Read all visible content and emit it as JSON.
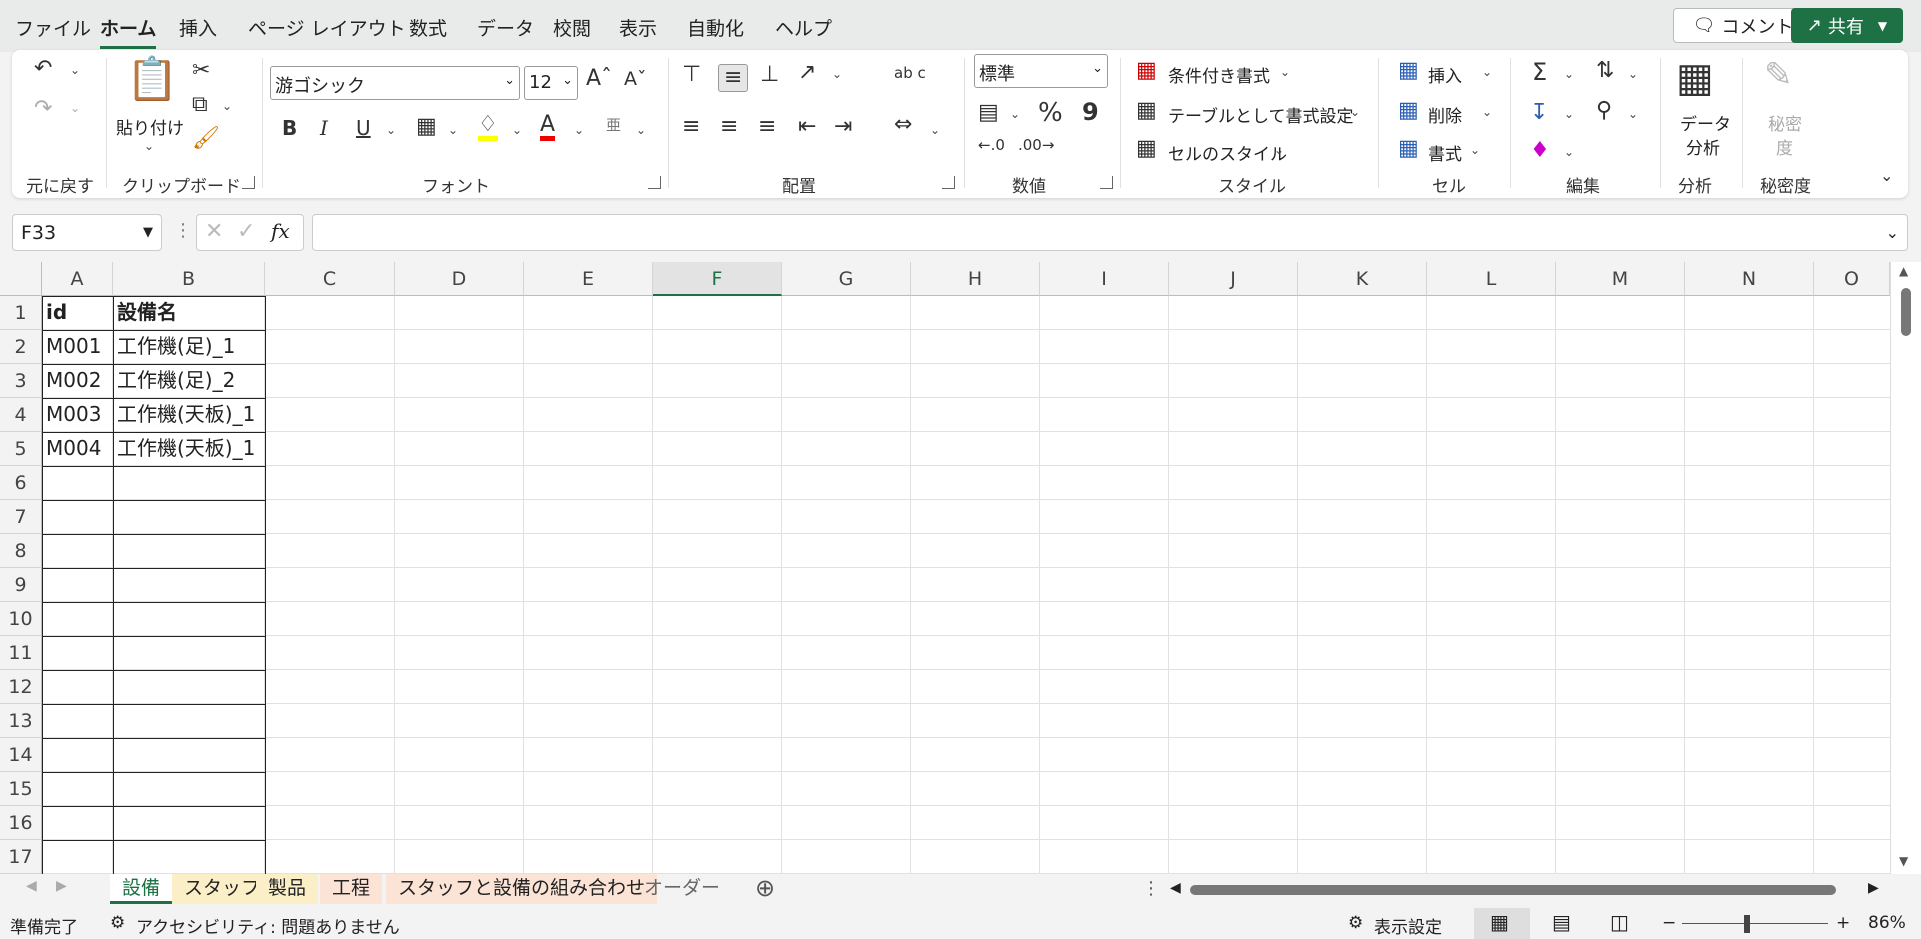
{
  "menu": {
    "tabs": [
      "ファイル",
      "ホーム",
      "挿入",
      "ページ レイアウト",
      "数式",
      "データ",
      "校閲",
      "表示",
      "自動化",
      "ヘルプ"
    ],
    "active": "ホーム",
    "comment_label": "コメント",
    "share_label": "共有"
  },
  "ribbon": {
    "groups": {
      "undo": "元に戻す",
      "clipboard": "クリップボード",
      "font": "フォント",
      "alignment": "配置",
      "number": "数値",
      "styles": "スタイル",
      "cells": "セル",
      "editing": "編集",
      "analysis": "分析",
      "sensitivity": "秘密度"
    },
    "paste_label": "貼り付け",
    "font_name": "游ゴシック",
    "font_size": "12",
    "number_format": "標準",
    "conditional_format": "条件付き書式",
    "format_as_table": "テーブルとして書式設定",
    "cell_styles": "セルのスタイル",
    "insert": "挿入",
    "delete": "削除",
    "format": "書式",
    "data_analysis_line1": "データ",
    "data_analysis_line2": "分析",
    "sensitivity_line1": "秘密",
    "sensitivity_line2": "度",
    "bold": "B",
    "italic": "I",
    "underline": "U",
    "wrap": "ab c",
    "percent": "%",
    "comma": "9",
    "phonetic": "亜"
  },
  "formula_bar": {
    "name_box": "F33",
    "formula": "",
    "fx": "fx"
  },
  "sheet": {
    "columns": [
      "A",
      "B",
      "C",
      "D",
      "E",
      "F",
      "G",
      "H",
      "I",
      "J",
      "K",
      "L",
      "M",
      "N",
      "O"
    ],
    "selected_column": "F",
    "rows": [
      "1",
      "2",
      "3",
      "4",
      "5",
      "6",
      "7",
      "8",
      "9",
      "10",
      "11",
      "12",
      "13",
      "14",
      "15",
      "16",
      "17"
    ],
    "cells": [
      [
        "id",
        "設備名"
      ],
      [
        "M001",
        "工作機(足)_1"
      ],
      [
        "M002",
        "工作機(足)_2"
      ],
      [
        "M003",
        "工作機(天板)_1"
      ],
      [
        "M004",
        "工作機(天板)_1"
      ]
    ]
  },
  "sheet_tabs": [
    "設備",
    "スタッフ",
    "製品",
    "工程",
    "スタッフと設備の組み合わせ",
    "オーダー"
  ],
  "active_sheet": "設備",
  "status": {
    "ready": "準備完了",
    "accessibility": "アクセシビリティ: 問題ありません",
    "display_settings": "表示設定",
    "zoom": "86%"
  },
  "colors": {
    "accent": "#1e7145",
    "font_highlight": "#ffff00",
    "font_color": "#ff0000"
  }
}
